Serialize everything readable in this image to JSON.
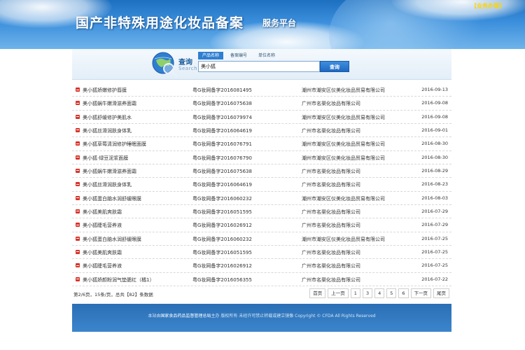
{
  "header": {
    "title": "国产非特殊用途化妆品备案",
    "subtitle": "服务平台",
    "service_link": "【业务办理】"
  },
  "search": {
    "logo_text": "查询",
    "logo_sub": "Search",
    "tabs": [
      {
        "label": "产品名称",
        "active": true
      },
      {
        "label": "备案编号",
        "active": false
      },
      {
        "label": "单位名称",
        "active": false
      }
    ],
    "query": "美小狐",
    "button_label": "查询"
  },
  "rows": [
    {
      "name": "美小狐娇嫩修护唇膜",
      "cert": "粤G妆网备字2016081495",
      "company": "潮州市潮安区仪美化妆品贸易有限公司",
      "date": "2016-09-13"
    },
    {
      "name": "美小狐蜗牛嫩滑滋养面霜",
      "cert": "粤G妆网备字2016075638",
      "company": "广州市名渠化妆品有限公司",
      "date": "2016-09-08"
    },
    {
      "name": "美小狐舒缓修护美肌水",
      "cert": "粤G妆网备字2016079974",
      "company": "潮州市潮安区仪美化妆品贸易有限公司",
      "date": "2016-09-08"
    },
    {
      "name": "美小狐丝滑润肤身体乳",
      "cert": "粤G妆网备字2016064619",
      "company": "广州市名渠化妆品有限公司",
      "date": "2016-09-01"
    },
    {
      "name": "美小狐草莓清润修护睡眠面膜",
      "cert": "粤G妆网备字2016076791",
      "company": "潮州市潮安区仪美化妆品贸易有限公司",
      "date": "2016-08-30"
    },
    {
      "name": "美小狐·绿豆泥浆面膜",
      "cert": "粤G妆网备字2016076790",
      "company": "潮州市潮安区仪美化妆品贸易有限公司",
      "date": "2016-08-30"
    },
    {
      "name": "美小狐蜗牛嫩滑滋养面霜",
      "cert": "粤G妆网备字2016075638",
      "company": "广州市名渠化妆品有限公司",
      "date": "2016-08-29"
    },
    {
      "name": "美小狐丝滑润肤身体乳",
      "cert": "粤G妆网备字2016064619",
      "company": "广州市名渠化妆品有限公司",
      "date": "2016-08-23"
    },
    {
      "name": "美小狐蛋白脑水润舒缓眼膜",
      "cert": "粤G妆网备字2016060232",
      "company": "潮州市潮安区仪美化妆品贸易有限公司",
      "date": "2016-08-03"
    },
    {
      "name": "美小狐美肌爽肤霜",
      "cert": "粤G妆网备字2016051595",
      "company": "广州市名渠化妆品有限公司",
      "date": "2016-07-29"
    },
    {
      "name": "美小狐睫毛营养液",
      "cert": "粤G妆网备字2016026912",
      "company": "广州市名渠化妆品有限公司",
      "date": "2016-07-29"
    },
    {
      "name": "美小狐蛋白脑水润舒缓眼膜",
      "cert": "粤G妆网备字2016060232",
      "company": "潮州市潮安区仪美化妆品贸易有限公司",
      "date": "2016-07-25"
    },
    {
      "name": "美小狐美肌爽肤霜",
      "cert": "粤G妆网备字2016051595",
      "company": "广州市名渠化妆品有限公司",
      "date": "2016-07-25"
    },
    {
      "name": "美小狐睫毛营养液",
      "cert": "粤G妆网备字2016026912",
      "company": "广州市名渠化妆品有限公司",
      "date": "2016-07-25"
    },
    {
      "name": "美小狐娇颜粉润气垫腮红（橘1）",
      "cert": "粤G妆网备字2016056355",
      "company": "广州市名渠化妆品有限公司",
      "date": "2016-07-22"
    }
  ],
  "pagination": {
    "info": "第2/6页，15条/页，总共【82】条数据",
    "first": "首页",
    "prev": "上一页",
    "pages": [
      "1",
      "3",
      "4",
      "5",
      "6"
    ],
    "next": "下一页",
    "last": "尾页"
  },
  "footer": {
    "prefix": "本站由",
    "org": "国家食品药品监督管理总局",
    "suffix": "主办 版权所有 未经许可禁止转载或建立镜像 Copyright © CFDA All Rights Reserved"
  },
  "colors": {
    "banner": "#3b8fdc",
    "accent": "#2f7fd0",
    "bullet": "#d9342b",
    "footer": "#2a6fb6"
  }
}
